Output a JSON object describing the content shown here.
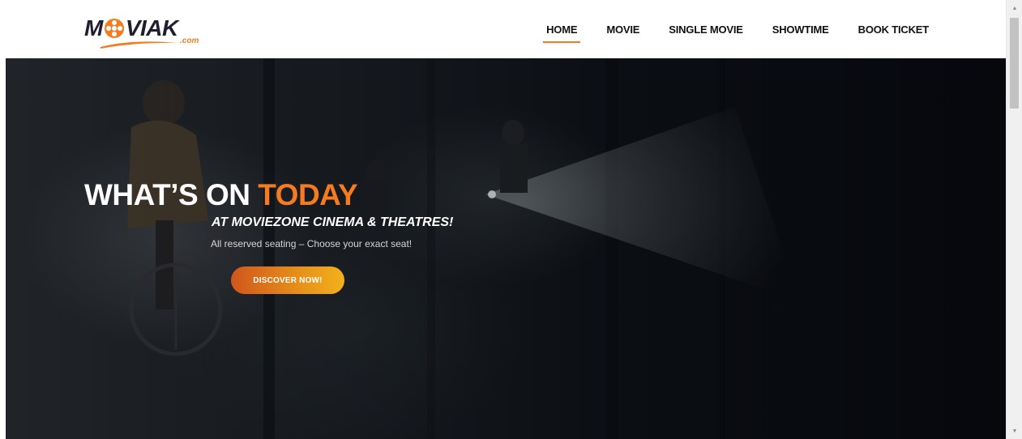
{
  "logo": {
    "text_left": "M",
    "text_right": "VIAK",
    "suffix": ".com"
  },
  "nav": {
    "items": [
      {
        "label": "HOME",
        "active": true
      },
      {
        "label": "MOVIE",
        "active": false
      },
      {
        "label": "SINGLE MOVIE",
        "active": false
      },
      {
        "label": "SHOWTIME",
        "active": false
      },
      {
        "label": "BOOK TICKET",
        "active": false
      }
    ]
  },
  "hero": {
    "title_main": "WHAT’S ON ",
    "title_accent": "TODAY",
    "subtitle": "AT MOVIEZONE CINEMA & THEATRES!",
    "text": "All reserved seating – Choose your exact seat!",
    "button_label": "DISCOVER NOW!"
  },
  "colors": {
    "accent": "#f47b20",
    "nav_text": "#111111",
    "hero_background": "#0e1218"
  },
  "icons": {
    "logo_reel": "film-reel-icon",
    "scroll_up": "triangle-up-icon",
    "scroll_down": "triangle-down-icon"
  }
}
